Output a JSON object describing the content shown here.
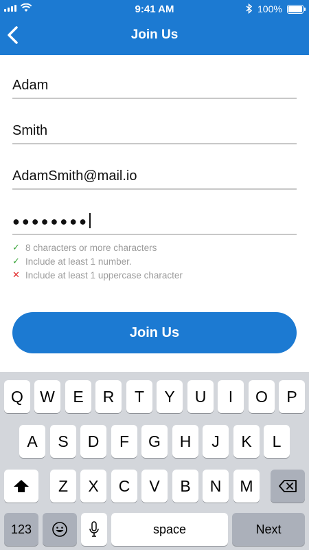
{
  "status_bar": {
    "time": "9:41 AM",
    "battery": "100%"
  },
  "nav": {
    "back_icon": "chevron-left-icon",
    "title": "Join Us"
  },
  "form": {
    "first_name": "Adam",
    "last_name": "Smith",
    "email": "AdamSmith@mail.io",
    "password_masked": "●●●●●●●●"
  },
  "password_rules": [
    {
      "text": "8 characters or more characters",
      "status": "met",
      "mark": "✓"
    },
    {
      "text": "Include at least 1 number.",
      "status": "met",
      "mark": "✓"
    },
    {
      "text": "Include at least 1 uppercase character",
      "status": "unmet",
      "mark": "✕"
    }
  ],
  "submit_button": "Join Us",
  "keyboard": {
    "row1": [
      "Q",
      "W",
      "E",
      "R",
      "T",
      "Y",
      "U",
      "I",
      "O",
      "P"
    ],
    "row2": [
      "A",
      "S",
      "D",
      "F",
      "G",
      "H",
      "J",
      "K",
      "L"
    ],
    "row3": [
      "Z",
      "X",
      "C",
      "V",
      "B",
      "N",
      "M"
    ],
    "numbers_key": "123",
    "space_key": "space",
    "return_key": "Next"
  },
  "colors": {
    "accent": "#1c7ad2",
    "rule_ok": "#3aa53a",
    "rule_bad": "#e02424",
    "keyboard_bg": "#d3d6db"
  }
}
